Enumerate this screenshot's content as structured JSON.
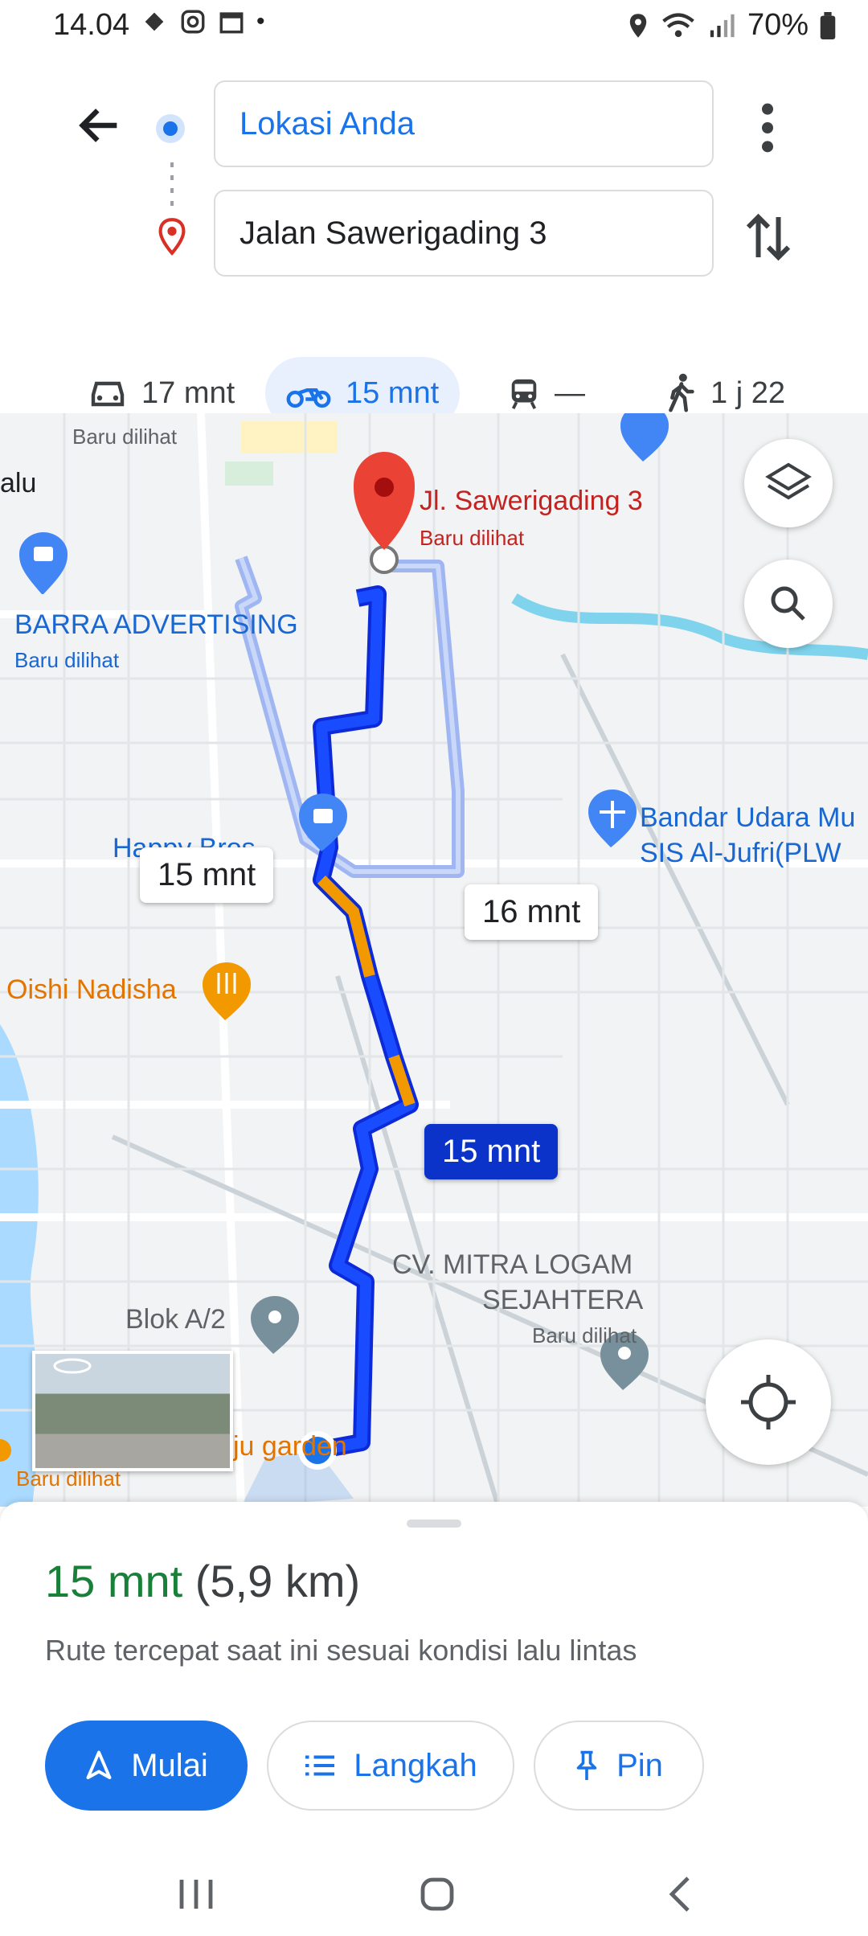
{
  "status": {
    "time": "14.04",
    "battery": "70%"
  },
  "header": {
    "origin": "Lokasi Anda",
    "destination": "Jalan Sawerigading 3"
  },
  "modes": [
    {
      "icon": "car-icon",
      "label": "17 mnt"
    },
    {
      "icon": "motorcycle-icon",
      "label": "15 mnt",
      "active": true
    },
    {
      "icon": "transit-icon",
      "label": "—"
    },
    {
      "icon": "walk-icon",
      "label": "1 j 22"
    }
  ],
  "map": {
    "labels": {
      "destination_name": "Jl. Sawerigading 3",
      "destination_sub": "Baru dilihat",
      "barra": "BARRA ADVERTISING",
      "barra_sub": "Baru dilihat",
      "top_sub": "Baru dilihat",
      "palu": "alu",
      "happy": "Happy Bros",
      "oishi": "Oishi Nadisha",
      "airport_1": "Bandar Udara Mu",
      "airport_2": "SIS Al-Jufri(PLW",
      "cv_1": "CV. MITRA LOGAM",
      "cv_2": "SEJAHTERA",
      "cv_sub": "Baru dilihat",
      "blok": "Blok A/2",
      "garden": "ju garden",
      "garden_sub": "Baru dilihat"
    },
    "chips": {
      "alt1": "15 mnt",
      "alt2": "16 mnt",
      "selected": "15 mnt"
    },
    "colors": {
      "route": "#0b3ff0",
      "traffic": "#f29900",
      "alt_route": "#9fb6f2"
    }
  },
  "sheet": {
    "time": "15 mnt",
    "distance": "(5,9 km)",
    "note": "Rute tercepat saat ini sesuai kondisi lalu lintas",
    "buttons": {
      "start": "Mulai",
      "steps": "Langkah",
      "pin": "Pin"
    }
  }
}
